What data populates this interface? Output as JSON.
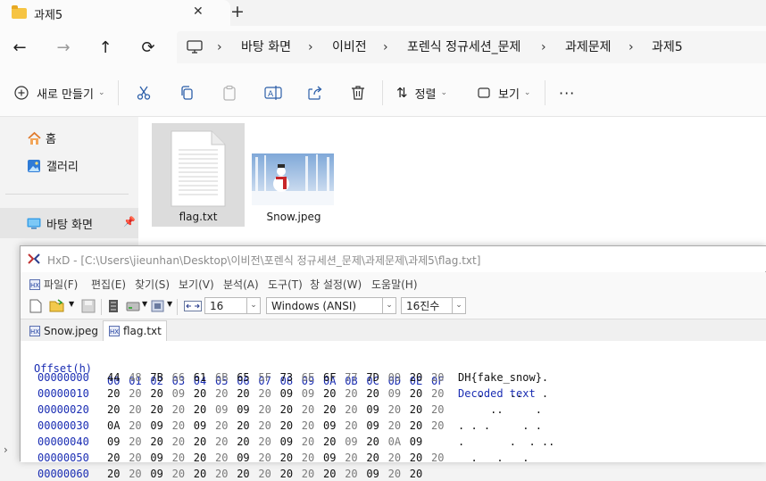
{
  "explorer": {
    "tab": {
      "title": "과제5",
      "close": "✕",
      "new_tab": "+"
    },
    "nav": {
      "back": "←",
      "forward": "→",
      "up": "↑",
      "refresh": "⟳"
    },
    "breadcrumbs": [
      "바탕 화면",
      "이비전",
      "포렌식 정규세션_문제",
      "과제문제",
      "과제5"
    ],
    "commands": {
      "new": "새로 만들기",
      "sort": "정렬",
      "view": "보기",
      "more": "···"
    },
    "sidebar": {
      "home": "홈",
      "gallery": "갤러리",
      "desktop": "바탕 화면"
    },
    "files": [
      {
        "name": "flag.txt",
        "selected": true
      },
      {
        "name": "Snow.jpeg",
        "selected": false
      }
    ]
  },
  "hxd": {
    "title": "HxD - [C:\\Users\\jieunhan\\Desktop\\이비전\\포렌식 정규세션_문제\\과제문제\\과제5\\flag.txt]",
    "menu": [
      "파일(F)",
      "편집(E)",
      "찾기(S)",
      "보기(V)",
      "분석(A)",
      "도구(T)",
      "창 설정(W)",
      "도움말(H)"
    ],
    "toolbar": {
      "bytes_per_row": "16",
      "charset": "Windows (ANSI)",
      "offset_base": "16진수"
    },
    "tabs": [
      "Snow.jpeg",
      "flag.txt"
    ],
    "header": {
      "offset_label": "Offset(h)",
      "columns": [
        "00",
        "01",
        "02",
        "03",
        "04",
        "05",
        "06",
        "07",
        "08",
        "09",
        "0A",
        "0B",
        "0C",
        "0D",
        "0E",
        "0F"
      ],
      "decoded_label": "Decoded text"
    },
    "rows": [
      {
        "offset": "00000000",
        "bytes": [
          "44",
          "48",
          "7B",
          "66",
          "61",
          "6B",
          "65",
          "5F",
          "73",
          "6E",
          "6F",
          "77",
          "7D",
          "09",
          "20",
          "20"
        ],
        "decoded": "DH{fake_snow}.  "
      },
      {
        "offset": "00000010",
        "bytes": [
          "20",
          "20",
          "20",
          "09",
          "20",
          "20",
          "20",
          "20",
          "09",
          "09",
          "20",
          "20",
          "20",
          "09",
          "20",
          "20"
        ],
        "decoded": "   .    ..   .  "
      },
      {
        "offset": "00000020",
        "bytes": [
          "20",
          "20",
          "20",
          "20",
          "20",
          "09",
          "09",
          "20",
          "20",
          "20",
          "20",
          "20",
          "09",
          "20",
          "20",
          "20"
        ],
        "decoded": "     ..     .   "
      },
      {
        "offset": "00000030",
        "bytes": [
          "0A",
          "20",
          "09",
          "20",
          "09",
          "20",
          "20",
          "20",
          "20",
          "20",
          "09",
          "20",
          "09",
          "20",
          "20",
          "20"
        ],
        "decoded": ". . .     . .   "
      },
      {
        "offset": "00000040",
        "bytes": [
          "09",
          "20",
          "20",
          "20",
          "20",
          "20",
          "20",
          "20",
          "09",
          "20",
          "20",
          "09",
          "20",
          "0A",
          "09"
        ],
        "decoded": ".       .  . .."
      },
      {
        "offset": "00000050",
        "bytes": [
          "20",
          "20",
          "09",
          "20",
          "20",
          "20",
          "09",
          "20",
          "20",
          "20",
          "09",
          "20",
          "20",
          "20",
          "20",
          "20"
        ],
        "decoded": "  .   .   .     "
      },
      {
        "offset": "00000060",
        "bytes": [
          "20",
          "20",
          "09",
          "20",
          "20",
          "20",
          "20",
          "20",
          "20",
          "20",
          "20",
          "20",
          "09",
          "20",
          "20"
        ],
        "decoded": ""
      }
    ]
  }
}
